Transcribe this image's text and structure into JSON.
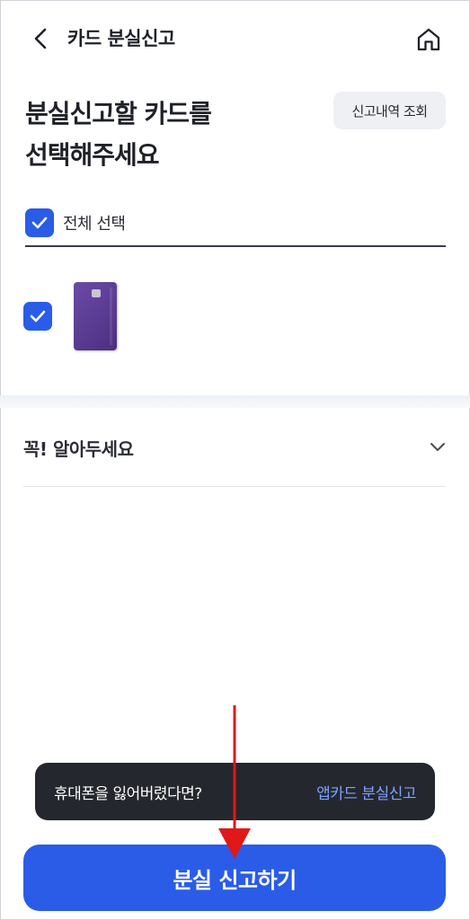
{
  "header": {
    "title": "카드 분실신고",
    "back_icon": "chevron-left-icon",
    "home_icon": "home-icon"
  },
  "main": {
    "title_line1": "분실신고할 카드를",
    "title_line2": "선택해주세요",
    "history_button": "신고내역 조회",
    "select_all_label": "전체 선택",
    "select_all_checked": true,
    "cards": [
      {
        "checked": true,
        "color": "#5a3c93"
      }
    ]
  },
  "notice": {
    "label": "꼭! 알아두세요",
    "expand_icon": "chevron-down-icon"
  },
  "toast": {
    "text": "휴대폰을 잃어버렸다면?",
    "link": "앱카드 분실신고"
  },
  "footer": {
    "primary_button": "분실 신고하기"
  },
  "colors": {
    "accent": "#2a5ce8",
    "toast_bg": "#24272d",
    "toast_link": "#7ea2ff",
    "annotation_arrow": "#e01818"
  }
}
